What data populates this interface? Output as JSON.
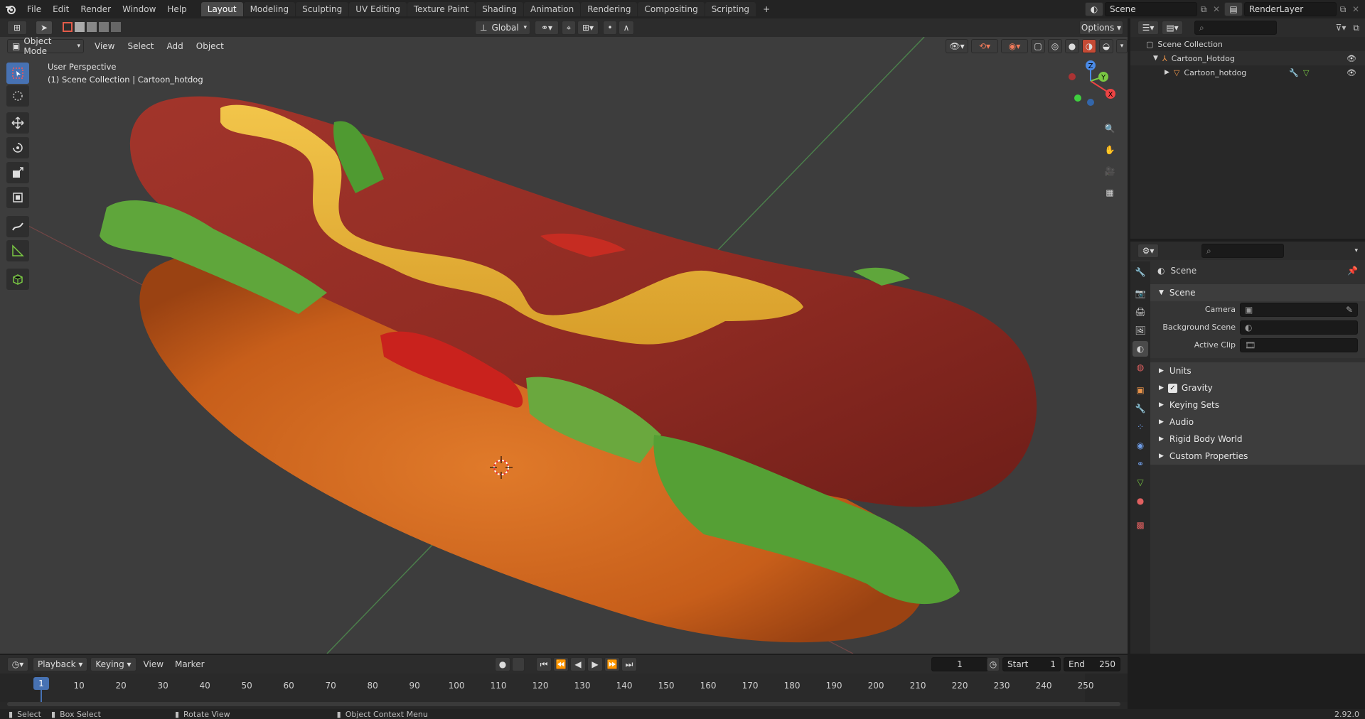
{
  "app": {
    "menu": [
      "File",
      "Edit",
      "Render",
      "Window",
      "Help"
    ],
    "workspaces": [
      "Layout",
      "Modeling",
      "Sculpting",
      "UV Editing",
      "Texture Paint",
      "Shading",
      "Animation",
      "Rendering",
      "Compositing",
      "Scripting"
    ],
    "active_workspace": "Layout",
    "add_tab": "+",
    "scene": "Scene",
    "view_layer": "RenderLayer"
  },
  "viewport": {
    "mode": "Object Mode",
    "menu": [
      "View",
      "Select",
      "Add",
      "Object"
    ],
    "orientation": "Global",
    "options": "Options",
    "overlay_text_1": "User Perspective",
    "overlay_text_2": "(1) Scene Collection | Cartoon_hotdog",
    "gizmo": {
      "x": "X",
      "y": "Y",
      "z": "Z"
    }
  },
  "outliner": {
    "root": "Scene Collection",
    "items": [
      {
        "name": "Cartoon_Hotdog"
      },
      {
        "name": "Cartoon_hotdog"
      }
    ]
  },
  "properties": {
    "header": "Scene",
    "section": "Scene",
    "fields": [
      {
        "label": "Camera"
      },
      {
        "label": "Background Scene"
      },
      {
        "label": "Active Clip"
      }
    ],
    "subpanels": [
      "Units",
      "Gravity",
      "Keying Sets",
      "Audio",
      "Rigid Body World",
      "Custom Properties"
    ]
  },
  "timeline": {
    "menu": [
      "Playback",
      "Keying",
      "View",
      "Marker"
    ],
    "current_frame": "1",
    "start_label": "Start",
    "start": "1",
    "end_label": "End",
    "end": "250",
    "playhead": "1",
    "ticks": [
      "10",
      "20",
      "30",
      "40",
      "50",
      "60",
      "70",
      "80",
      "90",
      "100",
      "110",
      "120",
      "130",
      "140",
      "150",
      "160",
      "170",
      "180",
      "190",
      "200",
      "210",
      "220",
      "230",
      "240",
      "250"
    ]
  },
  "statusbar": {
    "select": "Select",
    "box_select": "Box Select",
    "rotate": "Rotate View",
    "context": "Object Context Menu",
    "version": "2.92.0"
  },
  "colors": {
    "accent": "#4772b3",
    "bun": "#d5691f",
    "sausage": "#8f2b24",
    "mustard": "#e6b13a",
    "lettuce": "#5fa63b",
    "tomato": "#c9221d"
  }
}
